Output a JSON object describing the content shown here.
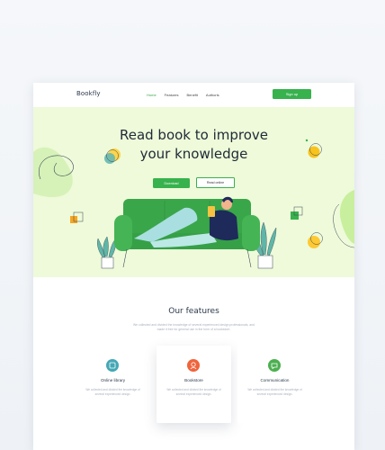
{
  "nav": {
    "logo": "Bookfly",
    "links": [
      "Home",
      "Features",
      "Benefit",
      "Authoris"
    ],
    "signup_label": "Sign up"
  },
  "hero": {
    "title_line1": "Read book to improve",
    "title_line2": "your knowledge",
    "download_label": "Download",
    "read_online_label": "Read online"
  },
  "features": {
    "title": "Our features",
    "subtitle": "We collected and divided the knowledge of several experienced design professionals, and made it free for general use in the form of a bookstore.",
    "cards": [
      {
        "title": "Online library",
        "desc": "We collected and divided the knowledge of several experienced design."
      },
      {
        "title": "Bookstore",
        "desc": "We collected and divided the knowledge of several experienced design."
      },
      {
        "title": "Communication",
        "desc": "We collected and divided the knowledge of several experienced design."
      }
    ]
  },
  "colors": {
    "brand_green": "#37b24d",
    "hero_bg": "#eefad9",
    "card_icon_blue": "#44a8b5",
    "card_icon_orange": "#f0643c",
    "card_icon_green": "#4caf50"
  }
}
